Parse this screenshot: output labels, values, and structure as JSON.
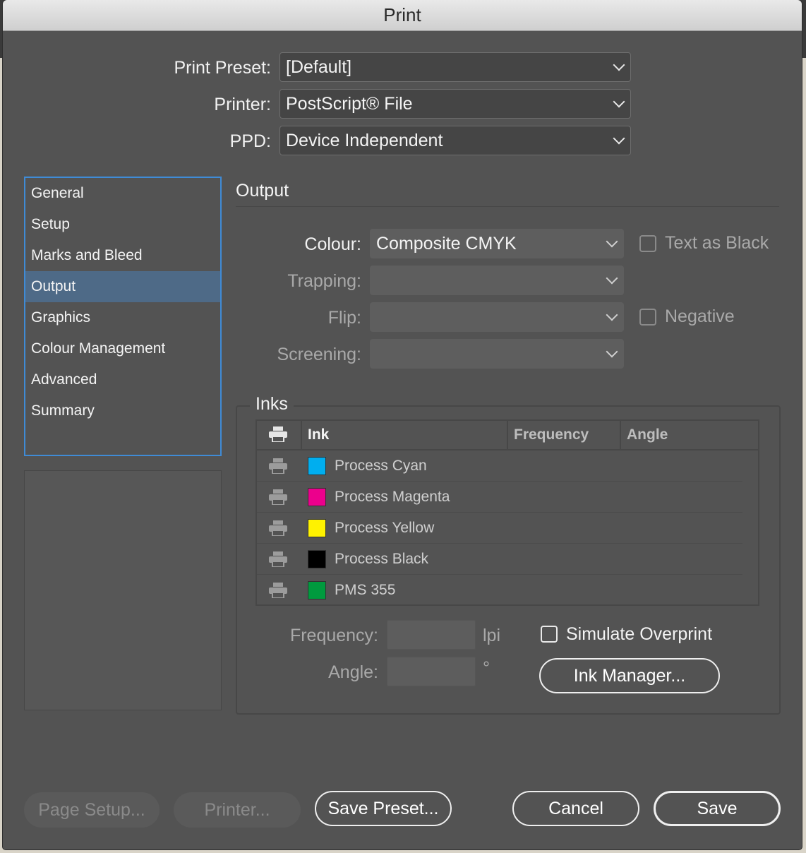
{
  "window": {
    "title": "Print"
  },
  "top": {
    "preset_label": "Print Preset:",
    "preset_value": "[Default]",
    "printer_label": "Printer:",
    "printer_value": "PostScript® File",
    "ppd_label": "PPD:",
    "ppd_value": "Device Independent"
  },
  "sidebar": {
    "items": [
      {
        "label": "General"
      },
      {
        "label": "Setup"
      },
      {
        "label": "Marks and Bleed"
      },
      {
        "label": "Output"
      },
      {
        "label": "Graphics"
      },
      {
        "label": "Colour Management"
      },
      {
        "label": "Advanced"
      },
      {
        "label": "Summary"
      }
    ],
    "selected": "Output"
  },
  "output": {
    "title": "Output",
    "colour_label": "Colour:",
    "colour_value": "Composite CMYK",
    "trapping_label": "Trapping:",
    "flip_label": "Flip:",
    "screening_label": "Screening:",
    "text_as_black": "Text as Black",
    "negative": "Negative"
  },
  "inks": {
    "legend": "Inks",
    "headers": {
      "ink": "Ink",
      "frequency": "Frequency",
      "angle": "Angle"
    },
    "rows": [
      {
        "name": "Process Cyan",
        "color": "#00aeef"
      },
      {
        "name": "Process Magenta",
        "color": "#ec008c"
      },
      {
        "name": "Process Yellow",
        "color": "#fff200"
      },
      {
        "name": "Process Black",
        "color": "#000000"
      },
      {
        "name": "PMS 355",
        "color": "#009a3e"
      }
    ],
    "frequency_label": "Frequency:",
    "frequency_unit": "lpi",
    "angle_label": "Angle:",
    "angle_unit": "°",
    "simulate_overprint": "Simulate Overprint",
    "ink_manager": "Ink Manager..."
  },
  "footer": {
    "page_setup": "Page Setup...",
    "printer": "Printer...",
    "save_preset": "Save Preset...",
    "cancel": "Cancel",
    "save": "Save"
  }
}
